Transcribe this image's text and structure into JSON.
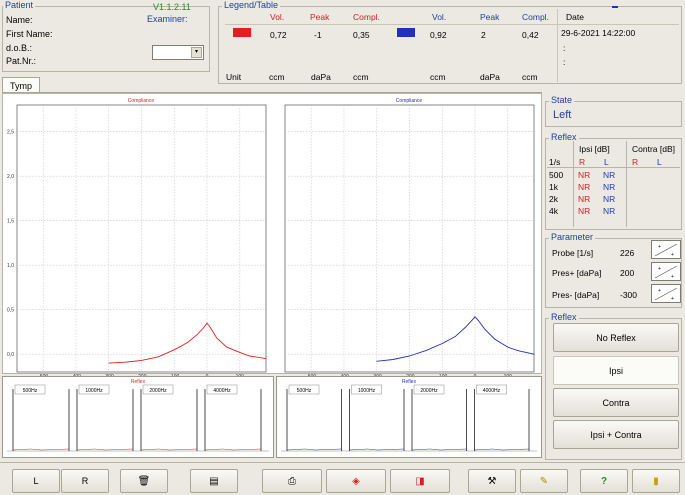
{
  "patient": {
    "title": "Patient",
    "version": "V1.1.2.11",
    "examiner_label": "Examiner:",
    "fields": [
      "Name:",
      "First Name:",
      "d.o.B.:",
      "Pat.Nr.:"
    ]
  },
  "legend": {
    "title": "Legend/Table",
    "headers": [
      "Vol.",
      "Peak",
      "Compl.",
      "Vol.",
      "Peak",
      "Compl.",
      "Date"
    ],
    "row_values": [
      "0,72",
      "-1",
      "0,35",
      "0,92",
      "2",
      "0,42",
      "29-6-2021 14:22:00"
    ],
    "extra_dates": [
      ":",
      ":"
    ],
    "unit_row": [
      "Unit",
      "ccm",
      "daPa",
      "ccm",
      "ccm",
      "daPa",
      "ccm"
    ],
    "colors": {
      "red": "#e02020",
      "blue": "#2030c0"
    }
  },
  "tabs": {
    "tymp": "Tymp"
  },
  "charts": {
    "left_title": "Compliance",
    "right_title": "Compliance",
    "reflex_label": "Reflex",
    "freq_labels": [
      "500Hz",
      "1000Hz",
      "2000Hz",
      "4000Hz"
    ]
  },
  "chart_data": [
    {
      "type": "line",
      "title": "Compliance",
      "xlabel": "",
      "ylabel": "",
      "xlim": [
        -580,
        180
      ],
      "ylim": [
        -0.2,
        2.8
      ],
      "x_ticks": [
        "-500",
        "-400",
        "-300",
        "-200",
        "-100",
        "0",
        "100"
      ],
      "y_ticks": [
        "0,0",
        "0,5",
        "1,0",
        "1,5",
        "2,0",
        "2,5"
      ],
      "grid": true,
      "color": "#e02020",
      "x": [
        -300,
        -250,
        -200,
        -150,
        -100,
        -60,
        -30,
        -10,
        0,
        10,
        30,
        60,
        100,
        130,
        180
      ],
      "y": [
        -0.1,
        -0.09,
        -0.07,
        -0.03,
        0.05,
        0.13,
        0.22,
        0.3,
        0.35,
        0.3,
        0.18,
        0.08,
        0.02,
        -0.02,
        -0.05
      ]
    },
    {
      "type": "line",
      "title": "Compliance",
      "xlabel": "",
      "ylabel": "",
      "xlim": [
        -580,
        180
      ],
      "ylim": [
        -0.2,
        2.8
      ],
      "x_ticks": [
        "-500",
        "-400",
        "-300",
        "-200",
        "-100",
        "0",
        "100"
      ],
      "y_ticks": [
        "0,0",
        "0,5",
        "1,0",
        "1,5",
        "2,0",
        "2,5"
      ],
      "grid": true,
      "color": "#2030c0",
      "x": [
        -300,
        -250,
        -200,
        -150,
        -100,
        -60,
        -30,
        -10,
        0,
        10,
        30,
        60,
        100,
        130,
        180
      ],
      "y": [
        -0.08,
        -0.06,
        -0.02,
        0.04,
        0.12,
        0.2,
        0.3,
        0.38,
        0.42,
        0.38,
        0.28,
        0.17,
        0.08,
        0.04,
        0.0
      ]
    }
  ],
  "state": {
    "title": "State",
    "value": "Left"
  },
  "reflex_table": {
    "title": "Reflex",
    "ipsi_header": "Ipsi [dB]",
    "contra_header": "Contra [dB]",
    "col_labels": [
      "1/s",
      "R",
      "L",
      "R",
      "L"
    ],
    "rows": [
      {
        "freq": "500",
        "r": "NR",
        "l": "NR"
      },
      {
        "freq": "1k",
        "r": "NR",
        "l": "NR"
      },
      {
        "freq": "2k",
        "r": "NR",
        "l": "NR"
      },
      {
        "freq": "4k",
        "r": "NR",
        "l": "NR"
      }
    ]
  },
  "parameter": {
    "title": "Parameter",
    "items": [
      {
        "label": "Probe [1/s]",
        "value": "226"
      },
      {
        "label": "Pres+ [daPa]",
        "value": "200"
      },
      {
        "label": "Pres- [daPa]",
        "value": "-300"
      }
    ]
  },
  "reflex_buttons": {
    "title": "Reflex",
    "items": [
      "No Reflex",
      "Ipsi",
      "Contra",
      "Ipsi + Contra"
    ]
  },
  "toolbar": {
    "left": "L",
    "right": "R",
    "help": "?"
  }
}
